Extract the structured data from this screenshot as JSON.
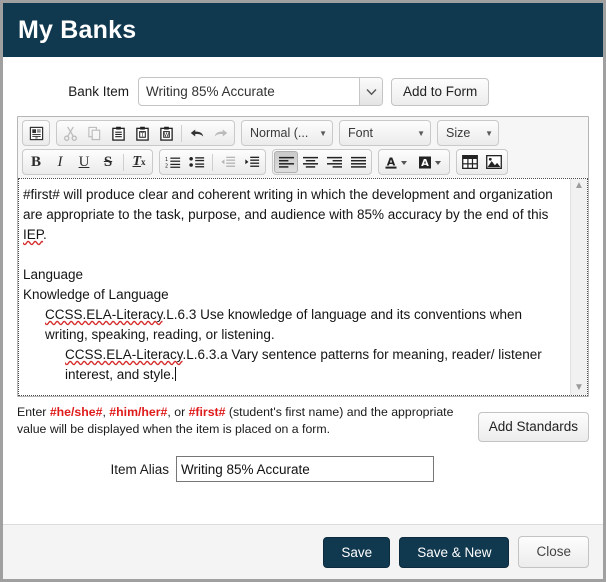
{
  "window": {
    "title": "My Banks",
    "header_color": "#10384f"
  },
  "bank_item": {
    "label": "Bank Item",
    "selected_value": "Writing 85% Accurate",
    "dropdown_icon": "chevron-down-icon",
    "add_button": "Add to Form"
  },
  "editor": {
    "toolbar_row1": [
      {
        "name": "templates-icon",
        "title": "Templates",
        "disabled": false
      },
      {
        "name": "cut-icon",
        "title": "Cut",
        "disabled": true
      },
      {
        "name": "copy-icon",
        "title": "Copy",
        "disabled": true
      },
      {
        "name": "paste-icon",
        "title": "Paste",
        "disabled": false
      },
      {
        "name": "paste-text-icon",
        "title": "Paste as plain text",
        "disabled": false
      },
      {
        "name": "paste-word-icon",
        "title": "Paste from Word",
        "disabled": false
      },
      {
        "name": "undo-icon",
        "title": "Undo",
        "disabled": false
      },
      {
        "name": "redo-icon",
        "title": "Redo",
        "disabled": true
      }
    ],
    "combos": [
      {
        "name": "paragraph-format-select",
        "label": "Normal (...",
        "arrow": "chevron-down-icon"
      },
      {
        "name": "font-family-select",
        "label": "Font",
        "arrow": "chevron-down-icon"
      },
      {
        "name": "font-size-select",
        "label": "Size",
        "arrow": "chevron-down-icon"
      }
    ],
    "toolbar_row2": [
      {
        "name": "bold-icon",
        "glyph": "B",
        "title": "Bold"
      },
      {
        "name": "italic-icon",
        "glyph": "I",
        "title": "Italic"
      },
      {
        "name": "underline-icon",
        "glyph": "U",
        "title": "Underline"
      },
      {
        "name": "strikethrough-icon",
        "glyph": "S",
        "title": "Strikethrough"
      },
      {
        "name": "remove-format-icon",
        "glyph": "Tx",
        "title": "Remove Format"
      },
      {
        "name": "numbered-list-icon",
        "title": "Insert/Remove Numbered List"
      },
      {
        "name": "bulleted-list-icon",
        "title": "Insert/Remove Bulleted List"
      },
      {
        "name": "outdent-icon",
        "title": "Decrease Indent",
        "disabled": true
      },
      {
        "name": "indent-icon",
        "title": "Increase Indent"
      },
      {
        "name": "align-left-icon",
        "title": "Align Left",
        "active": true
      },
      {
        "name": "align-center-icon",
        "title": "Center"
      },
      {
        "name": "align-right-icon",
        "title": "Align Right"
      },
      {
        "name": "align-justify-icon",
        "title": "Justify"
      },
      {
        "name": "text-color-icon",
        "glyph": "A",
        "title": "Text Color"
      },
      {
        "name": "background-color-icon",
        "glyph": "A",
        "title": "Background Color"
      },
      {
        "name": "table-icon",
        "title": "Table"
      },
      {
        "name": "image-icon",
        "title": "Image"
      }
    ],
    "content": {
      "paragraph1": "#first# will produce clear and coherent writing in which the development and organization are appropriate to the task, purpose, and audience with 85% accuracy by the end of this ",
      "paragraph1_misspelled": "IEP",
      "paragraph1_end": ".",
      "blank_line": "",
      "line_language": "Language",
      "line_knowledge": "Knowledge of Language",
      "standard1_code": "CCSS.ELA-Literacy",
      "standard1_text": ".L.6.3 Use knowledge of language and its conventions when writing, speaking, reading, or listening.",
      "standard2_code": "CCSS.ELA-Literacy",
      "standard2_text": ".L.6.3.a Vary sentence patterns for meaning, reader/ listener interest, and style."
    },
    "scrollbar": {
      "up": "chevron-up-icon",
      "down": "chevron-down-icon"
    }
  },
  "helper": {
    "prefix": "Enter ",
    "token1": "#he/she#",
    "sep1": ", ",
    "token2": "#him/her#",
    "sep2": ", or ",
    "token3": "#first#",
    "suffix": " (student's first name) and the appropriate value will be displayed when the item is placed on a form.",
    "add_standards_button": "Add Standards"
  },
  "alias": {
    "label": "Item Alias",
    "value": "Writing 85% Accurate"
  },
  "footer": {
    "save": "Save",
    "save_new": "Save & New",
    "close": "Close"
  }
}
